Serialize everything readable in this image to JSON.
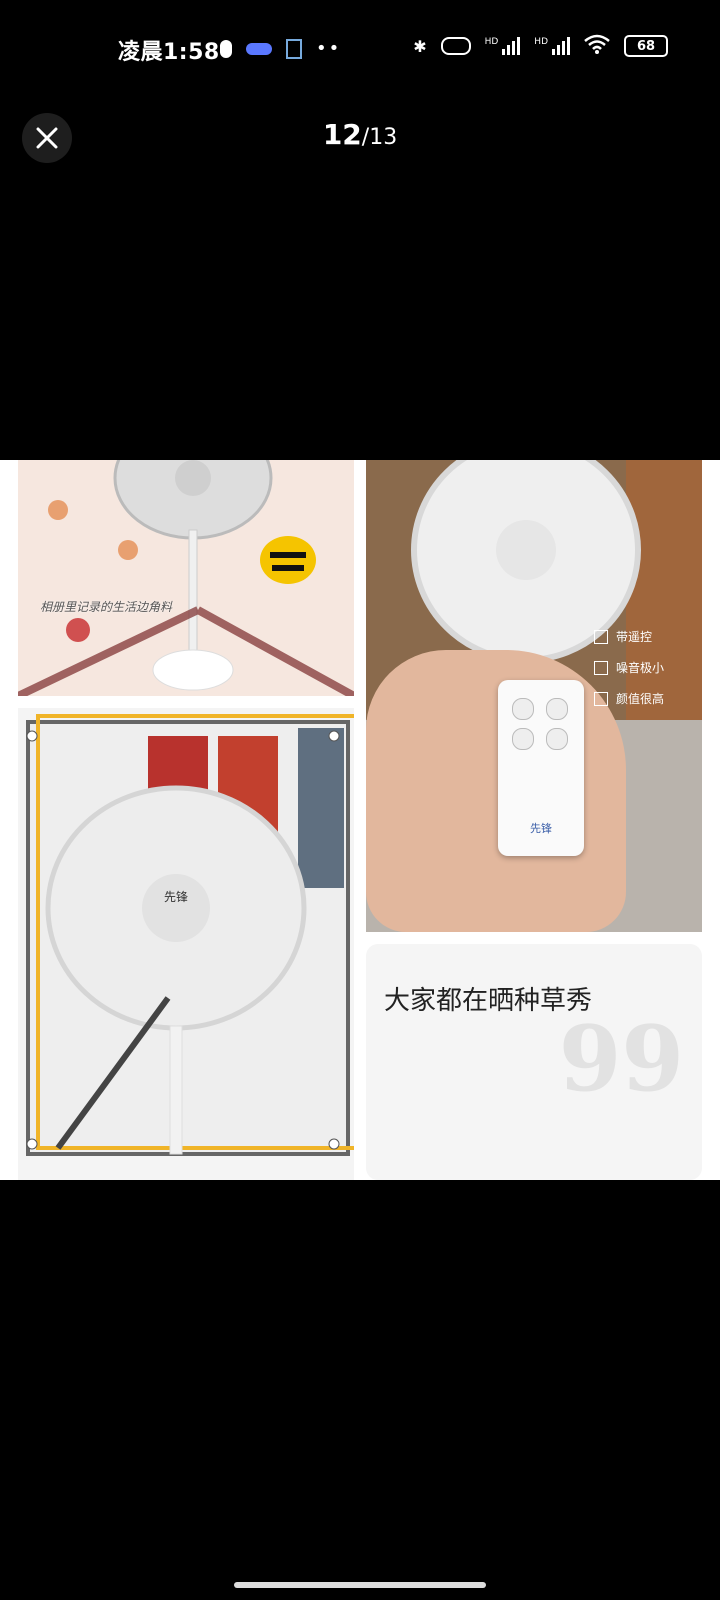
{
  "status_bar": {
    "time": "凌晨1:58",
    "battery": "68",
    "network_label_1": "HD",
    "network_label_2": "HD"
  },
  "viewer": {
    "current": "12",
    "total": "/13"
  },
  "tiles": {
    "tile1_caption": "相册里记录的生活边角料",
    "tile2_features": [
      "带遥控",
      "噪音极小",
      "颜值很高"
    ],
    "tile2_brand": "先锋",
    "tile3_brand": "先锋"
  },
  "quote_card": {
    "text": "大家都在晒种草秀",
    "mark": "99"
  },
  "icons": {
    "close": "close-icon",
    "bluetooth": "bluetooth-icon",
    "wifi": "wifi-icon"
  }
}
